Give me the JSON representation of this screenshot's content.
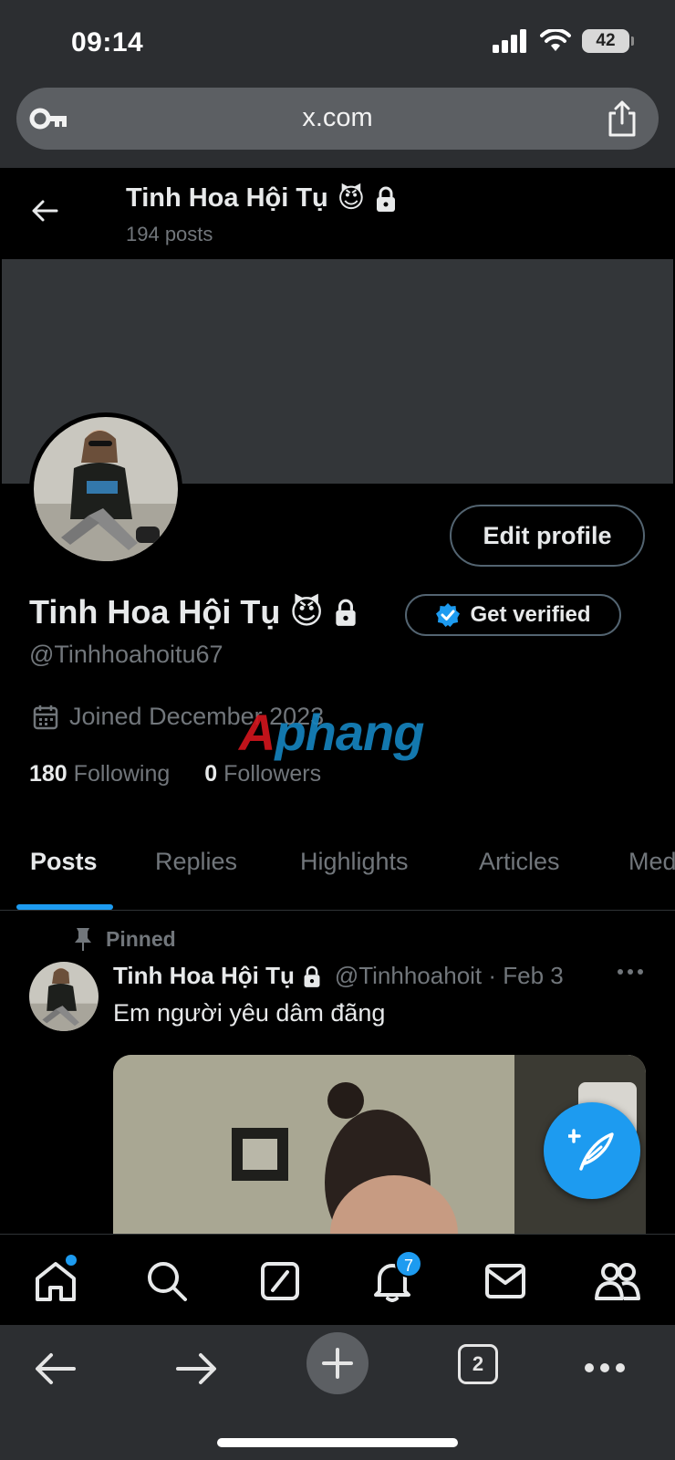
{
  "status_bar": {
    "time": "09:14",
    "battery": "42"
  },
  "browser": {
    "url": "x.com",
    "tab_count": "2"
  },
  "header": {
    "name": "Tinh Hoa Hội Tụ",
    "emoji": "😈",
    "posts": "194 posts"
  },
  "profile": {
    "name": "Tinh Hoa Hội Tụ",
    "emoji": "😈",
    "handle": "@Tinhhoahoitu67",
    "edit_label": "Edit profile",
    "verify_label": "Get verified",
    "joined": "Joined December 2023",
    "following_count": "180",
    "following_label": "Following",
    "followers_count": "0",
    "followers_label": "Followers"
  },
  "watermark": {
    "part1": "A",
    "part2": "phang"
  },
  "tabs": [
    "Posts",
    "Replies",
    "Highlights",
    "Articles",
    "Media"
  ],
  "active_tab": "Posts",
  "pinned_post": {
    "pinned_label": "Pinned",
    "author": "Tinh Hoa Hội Tụ",
    "handle": "@Tinhhoahoit",
    "date": "Feb 3",
    "text": "Em người yêu dâm đãng"
  },
  "nav": {
    "notifications_badge": "7"
  },
  "colors": {
    "accent": "#1d9bf0",
    "background": "#000000",
    "muted": "#71767b",
    "chrome": "#2c2e31"
  },
  "icons": [
    "key-icon",
    "share-icon",
    "back-arrow-icon",
    "lock-icon",
    "verified-badge-icon",
    "calendar-icon",
    "pin-icon",
    "more-icon",
    "compose-icon",
    "home-icon",
    "search-icon",
    "grok-icon",
    "notifications-icon",
    "messages-icon",
    "communities-icon",
    "chevron-left-icon",
    "chevron-right-icon",
    "plus-icon"
  ]
}
